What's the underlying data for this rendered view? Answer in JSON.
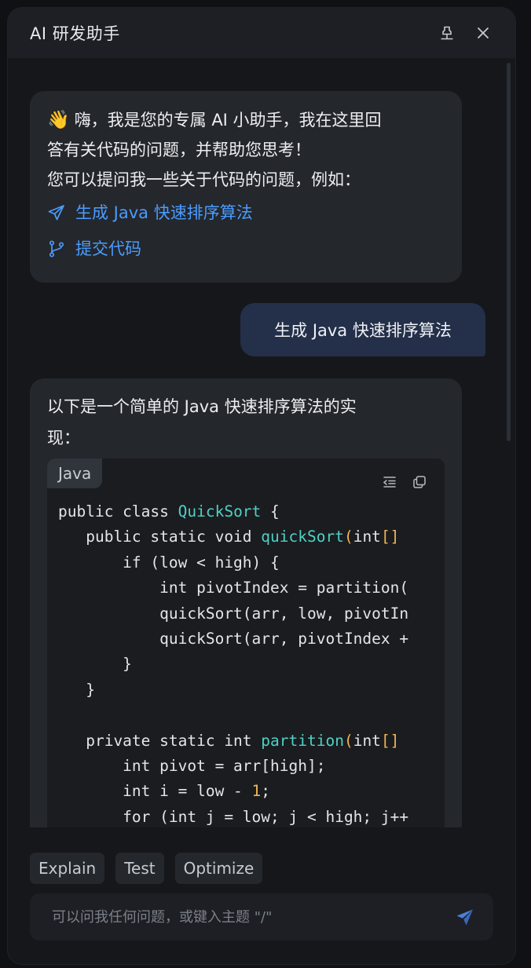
{
  "window": {
    "title": "AI 研发助手"
  },
  "titlebar": {
    "pin_icon": "pin-icon",
    "close_icon": "close-icon"
  },
  "welcome": {
    "emoji": "👋",
    "line1": "嗨，我是您的专属 AI 小助手，我在这里回",
    "line2": "答有关代码的问题，并帮助您思考！",
    "line3": "您可以提问我一些关于代码的问题，例如：",
    "suggestions": [
      {
        "icon": "send-icon",
        "label": "生成 Java 快速排序算法"
      },
      {
        "icon": "git-branch-icon",
        "label": "提交代码"
      }
    ]
  },
  "user_message": {
    "text": "生成 Java 快速排序算法"
  },
  "answer": {
    "line1": "以下是一个简单的 Java 快速排序算法的实",
    "line2": "现：",
    "code": {
      "language": "Java",
      "tool_icons": [
        "wrap-icon",
        "copy-icon"
      ]
    }
  },
  "quick_actions": [
    "Explain",
    "Test",
    "Optimize"
  ],
  "composer": {
    "placeholder": "可以问我任何问题，或键入主题 \"/\"",
    "value": "",
    "send_icon": "send-icon"
  },
  "colors": {
    "accent": "#4b9cff",
    "function": "#4fd1c5",
    "number": "#f2b452",
    "panel": "#15171b",
    "bubble": "#24272c",
    "user_bubble": "#243049"
  }
}
